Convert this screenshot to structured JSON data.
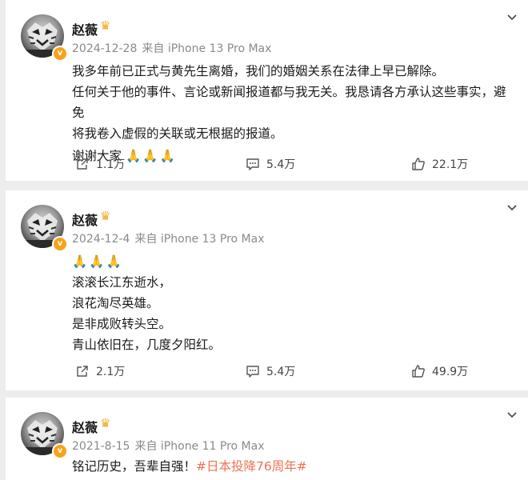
{
  "posts": [
    {
      "author": "赵薇",
      "date": "2024-12-28",
      "source": "来自 iPhone 13 Pro Max",
      "lines": [
        "我多年前已正式与黄先生离婚，我们的婚姻关系在法律上早已解除。",
        "任何关于他的事件、言论或新闻报道都与我无关。我恳请各方承认这些事实，避免",
        "将我卷入虚假的关联或无根据的报道。",
        "谢谢大家"
      ],
      "emoji": "🙏🙏🙏",
      "reposts": "1.1万",
      "comments": "5.4万",
      "likes": "22.1万"
    },
    {
      "author": "赵薇",
      "date": "2024-12-4",
      "source": "来自 iPhone 13 Pro Max",
      "emoji": "🙏🙏🙏",
      "lines": [
        "滚滚长江东逝水，",
        "浪花淘尽英雄。",
        "是非成败转头空。",
        "青山依旧在，几度夕阳红。"
      ],
      "reposts": "2.1万",
      "comments": "5.4万",
      "likes": "49.9万"
    },
    {
      "author": "赵薇",
      "date": "2021-8-15",
      "source": "来自 iPhone 11 Pro Max",
      "text": "铭记历史，吾辈自强！",
      "hashtag": "#日本投降76周年#"
    }
  ],
  "icons": {
    "verified": "verified-badge-icon",
    "crown": "crown-icon",
    "caret": "chevron-down-icon",
    "repost": "repost-icon",
    "comment": "comment-icon",
    "like": "like-icon"
  },
  "colors": {
    "hashtag": "#eb7350",
    "badge": "#f7a21a",
    "meta": "#8a8a8a"
  }
}
